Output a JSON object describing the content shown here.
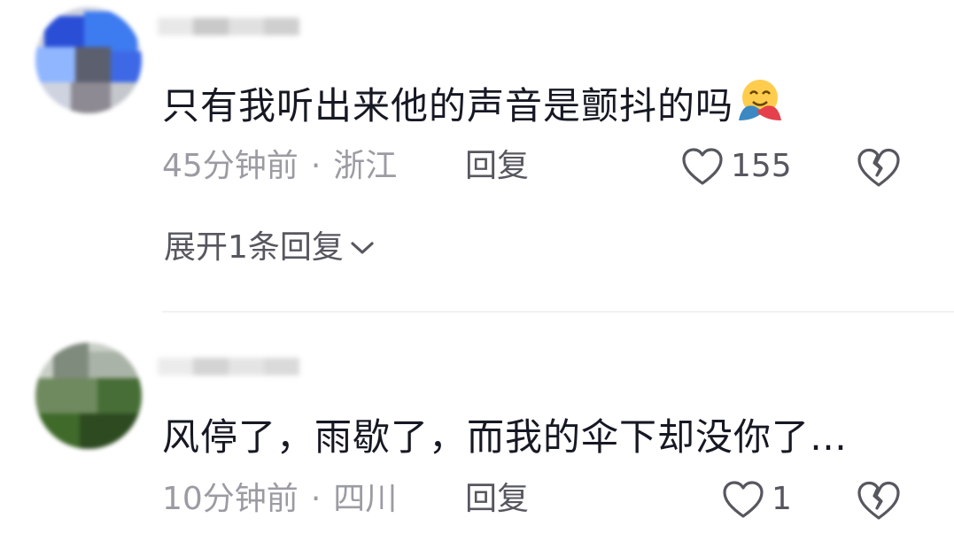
{
  "comments": [
    {
      "text": "只有我听出来他的声音是颤抖的吗",
      "emoji": "hug-emoji",
      "time": "45分钟前",
      "separator": "·",
      "location": "浙江",
      "reply_label": "回复",
      "like_count": "155",
      "expand_label": "展开1条回复"
    },
    {
      "text": "风停了，雨歇了，而我的伞下却没你了…",
      "time": "10分钟前",
      "separator": "·",
      "location": "四川",
      "reply_label": "回复",
      "like_count": "1"
    }
  ],
  "icons": {
    "like": "heart-outline-icon",
    "dislike": "broken-heart-icon",
    "expand": "chevron-down-icon"
  },
  "colors": {
    "text": "#161823",
    "meta": "#9b9ca3",
    "action": "#56575f"
  }
}
